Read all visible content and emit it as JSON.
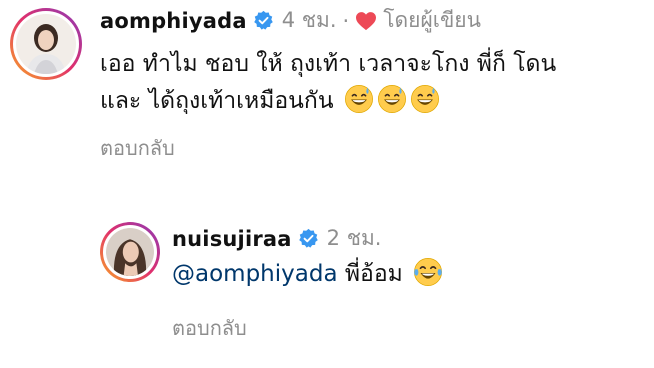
{
  "comments": [
    {
      "username": "aomphiyada",
      "time": "4 ชม.",
      "separator": "·",
      "liked_by_author": "โดยผู้เขียน",
      "text_line1": "เออ ทำไม ชอบ ให้ ถุงเท้า เวลาจะโกง พี่ก็ โดน",
      "text_line2": "และ ได้ถุงเท้าเหมือนกัน",
      "emojis": [
        "grinning-sweat-emoji",
        "grinning-sweat-emoji",
        "grinning-sweat-emoji"
      ],
      "reply_label": "ตอบกลับ"
    },
    {
      "username": "nuisujiraa",
      "time": "2 ชม.",
      "mention": "@aomphiyada",
      "text": "พี่อ้อม",
      "emojis": [
        "tears-of-joy-emoji"
      ],
      "reply_label": "ตอบกลับ"
    }
  ],
  "colors": {
    "verified": "#3897f0",
    "heart": "#ed4956",
    "muted": "#8e8e8e",
    "mention": "#00376b"
  }
}
